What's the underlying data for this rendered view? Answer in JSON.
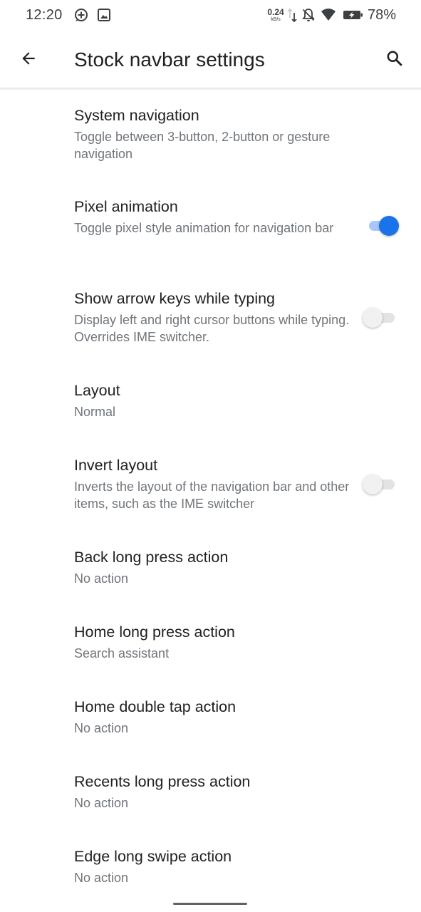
{
  "status_bar": {
    "time": "12:20",
    "net_speed": "0.24",
    "net_unit": "kB/s",
    "battery_percent": "78%",
    "icons": [
      "add-circle-icon",
      "image-icon",
      "network-activity-icon",
      "notifications-off-icon",
      "wifi-icon",
      "battery-charging-icon"
    ]
  },
  "app_bar": {
    "title": "Stock navbar settings",
    "back_icon": "arrow-back-icon",
    "search_icon": "search-icon"
  },
  "colors": {
    "accent": "#1a73e8",
    "title_text": "#202124",
    "summary_text": "#70757a"
  },
  "preferences": [
    {
      "title": "System navigation",
      "summary": "Toggle between 3-button, 2-button or gesture navigation"
    },
    {
      "title": "Pixel animation",
      "summary": "Toggle pixel style animation for navigation bar",
      "switch": true
    },
    {
      "title": "Show arrow keys while typing",
      "summary": "Display left and right cursor buttons while typing. Overrides IME switcher.",
      "switch": false
    },
    {
      "title": "Layout",
      "summary": "Normal"
    },
    {
      "title": "Invert layout",
      "summary": "Inverts the layout of the navigation bar and other items, such as the IME switcher",
      "switch": false
    },
    {
      "title": "Back long press action",
      "summary": "No action"
    },
    {
      "title": "Home long press action",
      "summary": "Search assistant"
    },
    {
      "title": "Home double tap action",
      "summary": "No action"
    },
    {
      "title": "Recents long press action",
      "summary": "No action"
    },
    {
      "title": "Edge long swipe action",
      "summary": "No action"
    }
  ]
}
